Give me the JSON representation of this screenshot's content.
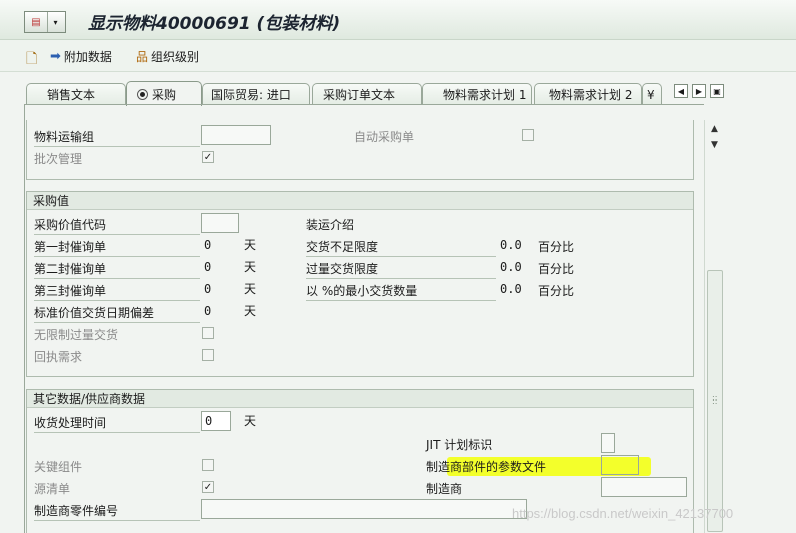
{
  "header": {
    "title": "显示物料40000691 (包装材料)"
  },
  "toolbar": {
    "additional_data": "附加数据",
    "org_levels": "组织级别"
  },
  "tabs": [
    {
      "label": "销售文本"
    },
    {
      "label": "采购"
    },
    {
      "label": "国际贸易: 进口"
    },
    {
      "label": "采购订单文本"
    },
    {
      "label": "物料需求计划 1"
    },
    {
      "label": "物料需求计划 2"
    },
    {
      "label": "¥"
    }
  ],
  "top_section": {
    "material_freight_group": "物料运输组",
    "auto_po": "自动采购单",
    "batch_management": "批次管理",
    "batch_management_checked": true
  },
  "purchasing_values": {
    "title": "采购值",
    "purch_value_key": "采购价值代码",
    "reminder1": "第一封催询单",
    "reminder1_value": "0",
    "reminder2": "第二封催询单",
    "reminder2_value": "0",
    "reminder3": "第三封催询单",
    "reminder3_value": "0",
    "std_deviation": "标准价值交货日期偏差",
    "std_deviation_value": "0",
    "days_unit": "天",
    "shipping_instr": "装运介绍",
    "underdelivery_tol": "交货不足限度",
    "underdelivery_value": "0.0",
    "overdelivery_tol": "过量交货限度",
    "overdelivery_value": "0.0",
    "min_delivery_qty": "以 %的最小交货数量",
    "min_delivery_value": "0.0",
    "percent_unit": "百分比",
    "unlimited_overdelivery": "无限制过量交货",
    "acknowledgment_reqd": "回执需求"
  },
  "other_data": {
    "title": "其它数据/供应商数据",
    "gr_processing_time": "收货处理时间",
    "gr_processing_value": "0",
    "days_unit": "天",
    "jit_indicator": "JIT 计划标识",
    "critical_component": "关键组件",
    "mpn_profile": "制造商部件的参数文件",
    "source_list": "源清单",
    "source_list_checked": true,
    "manufacturer": "制造商",
    "mfr_part_number": "制造商零件编号"
  },
  "watermark": "https://blog.csdn.net/weixin_42137700",
  "colors": {
    "highlight": "#f3ff1a",
    "background": "#f1f4f1"
  }
}
